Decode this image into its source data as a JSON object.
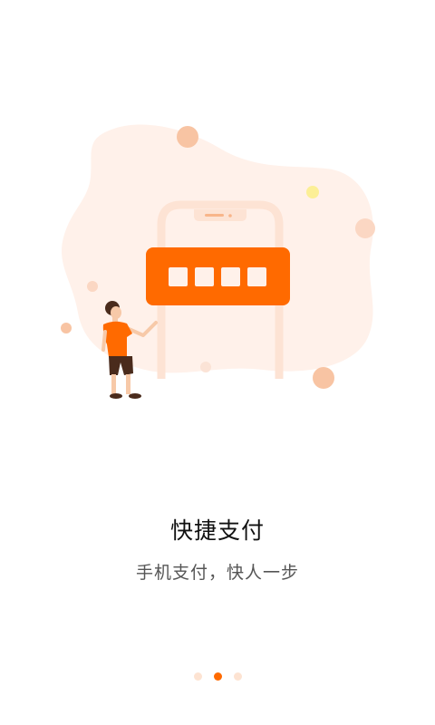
{
  "onboarding": {
    "title": "快捷支付",
    "subtitle": "手机支付，快人一步",
    "illustration_icon": "payment-phone-illustration",
    "accent_color": "#ff6a00",
    "pager": {
      "total": 3,
      "active_index": 1
    }
  }
}
